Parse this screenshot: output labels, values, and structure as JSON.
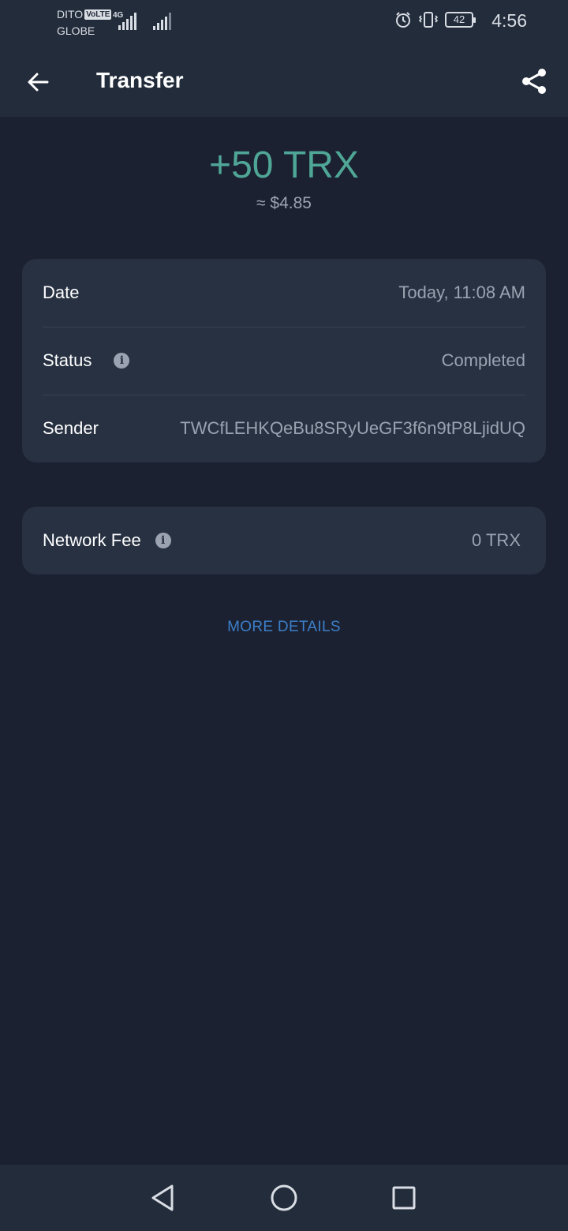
{
  "status_bar": {
    "carrier_1": "DITO",
    "volte": "VoLTE",
    "carrier_2": "GLOBE",
    "network_type": "4G",
    "battery_level": "42",
    "time": "4:56"
  },
  "app_bar": {
    "title": "Transfer",
    "back_icon": "arrow-left-icon",
    "share_icon": "share-icon"
  },
  "transaction": {
    "amount": "+50 TRX",
    "fiat_value": "≈ $4.85",
    "amount_color": "#4fa697"
  },
  "details": [
    {
      "label": "Date",
      "value": "Today, 11:08 AM",
      "info": false
    },
    {
      "label": "Status",
      "value": "Completed",
      "info": true
    },
    {
      "label": "Sender",
      "value": "TWCfLEHKQeBu8SRyUeGF3f6n9tP8LjidUQ",
      "info": false
    }
  ],
  "fee": {
    "label": "Network Fee",
    "value": "0 TRX",
    "info": true
  },
  "more_details_label": "MORE DETAILS",
  "nav_bar": {
    "back": "triangle-back-icon",
    "home": "circle-home-icon",
    "recents": "square-recents-icon"
  },
  "colors": {
    "background": "#1b2130",
    "card": "#273142",
    "link": "#3c7fca"
  }
}
